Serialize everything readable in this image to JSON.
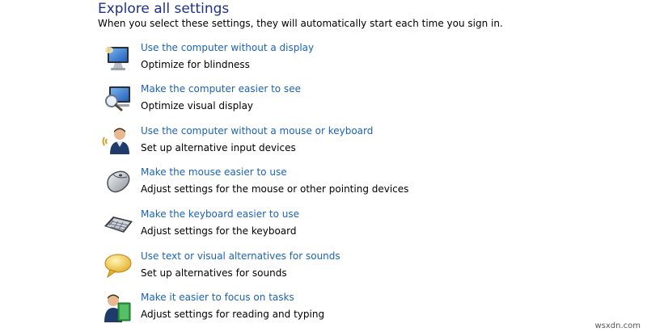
{
  "header": {
    "title": "Explore all settings",
    "description": "When you select these settings, they will automatically start each time you sign in."
  },
  "items": [
    {
      "icon": "monitor-icon",
      "link": "Use the computer without a display",
      "sub": "Optimize for blindness"
    },
    {
      "icon": "magnifier-monitor-icon",
      "link": "Make the computer easier to see",
      "sub": "Optimize visual display"
    },
    {
      "icon": "person-speaking-icon",
      "link": "Use the computer without a mouse or keyboard",
      "sub": "Set up alternative input devices"
    },
    {
      "icon": "mouse-icon",
      "link": "Make the mouse easier to use",
      "sub": "Adjust settings for the mouse or other pointing devices"
    },
    {
      "icon": "keyboard-icon",
      "link": "Make the keyboard easier to use",
      "sub": "Adjust settings for the keyboard"
    },
    {
      "icon": "speech-bubble-icon",
      "link": "Use text or visual alternatives for sounds",
      "sub": "Set up alternatives for sounds"
    },
    {
      "icon": "person-book-icon",
      "link": "Make it easier to focus on tasks",
      "sub": "Adjust settings for reading and typing"
    }
  ],
  "watermark": "wsxdn.com"
}
